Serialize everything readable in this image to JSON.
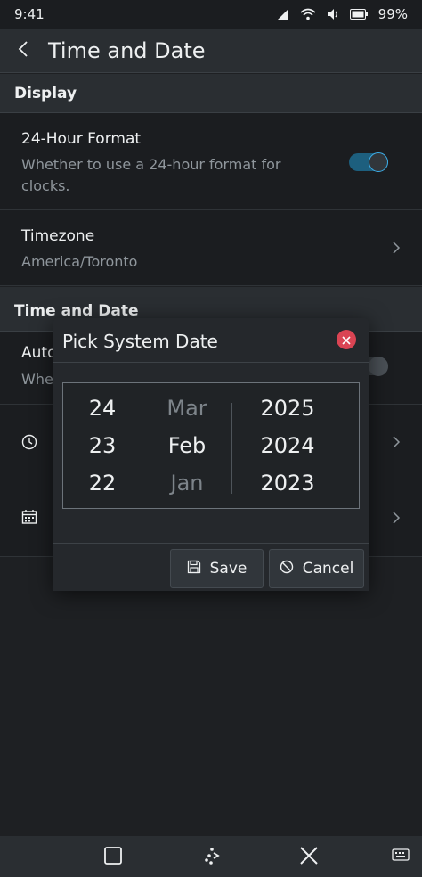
{
  "status_bar": {
    "time": "9:41",
    "battery": "99%"
  },
  "header": {
    "title": "Time and Date"
  },
  "sections": {
    "display": "Display",
    "time_and_date": "Time and Date"
  },
  "rows": {
    "format": {
      "title": "24-Hour Format",
      "subtitle_line1": "Whether to use a 24-hour format for",
      "subtitle_line2": "clocks.",
      "enabled": true
    },
    "timezone": {
      "title": "Timezone",
      "value": "America/Toronto"
    },
    "auto": {
      "title_partial": "Auto",
      "subtitle_partial": "Whe"
    }
  },
  "dialog": {
    "title": "Pick System Date",
    "days": [
      "24",
      "23",
      "22"
    ],
    "months": [
      "Mar",
      "Feb",
      "Jan"
    ],
    "years": [
      "2025",
      "2024",
      "2023"
    ],
    "save_label": "Save",
    "cancel_label": "Cancel"
  },
  "colors": {
    "accent": "#3daee9",
    "toggle_on_track": "#1d5f7e",
    "close_red": "#da4453"
  }
}
